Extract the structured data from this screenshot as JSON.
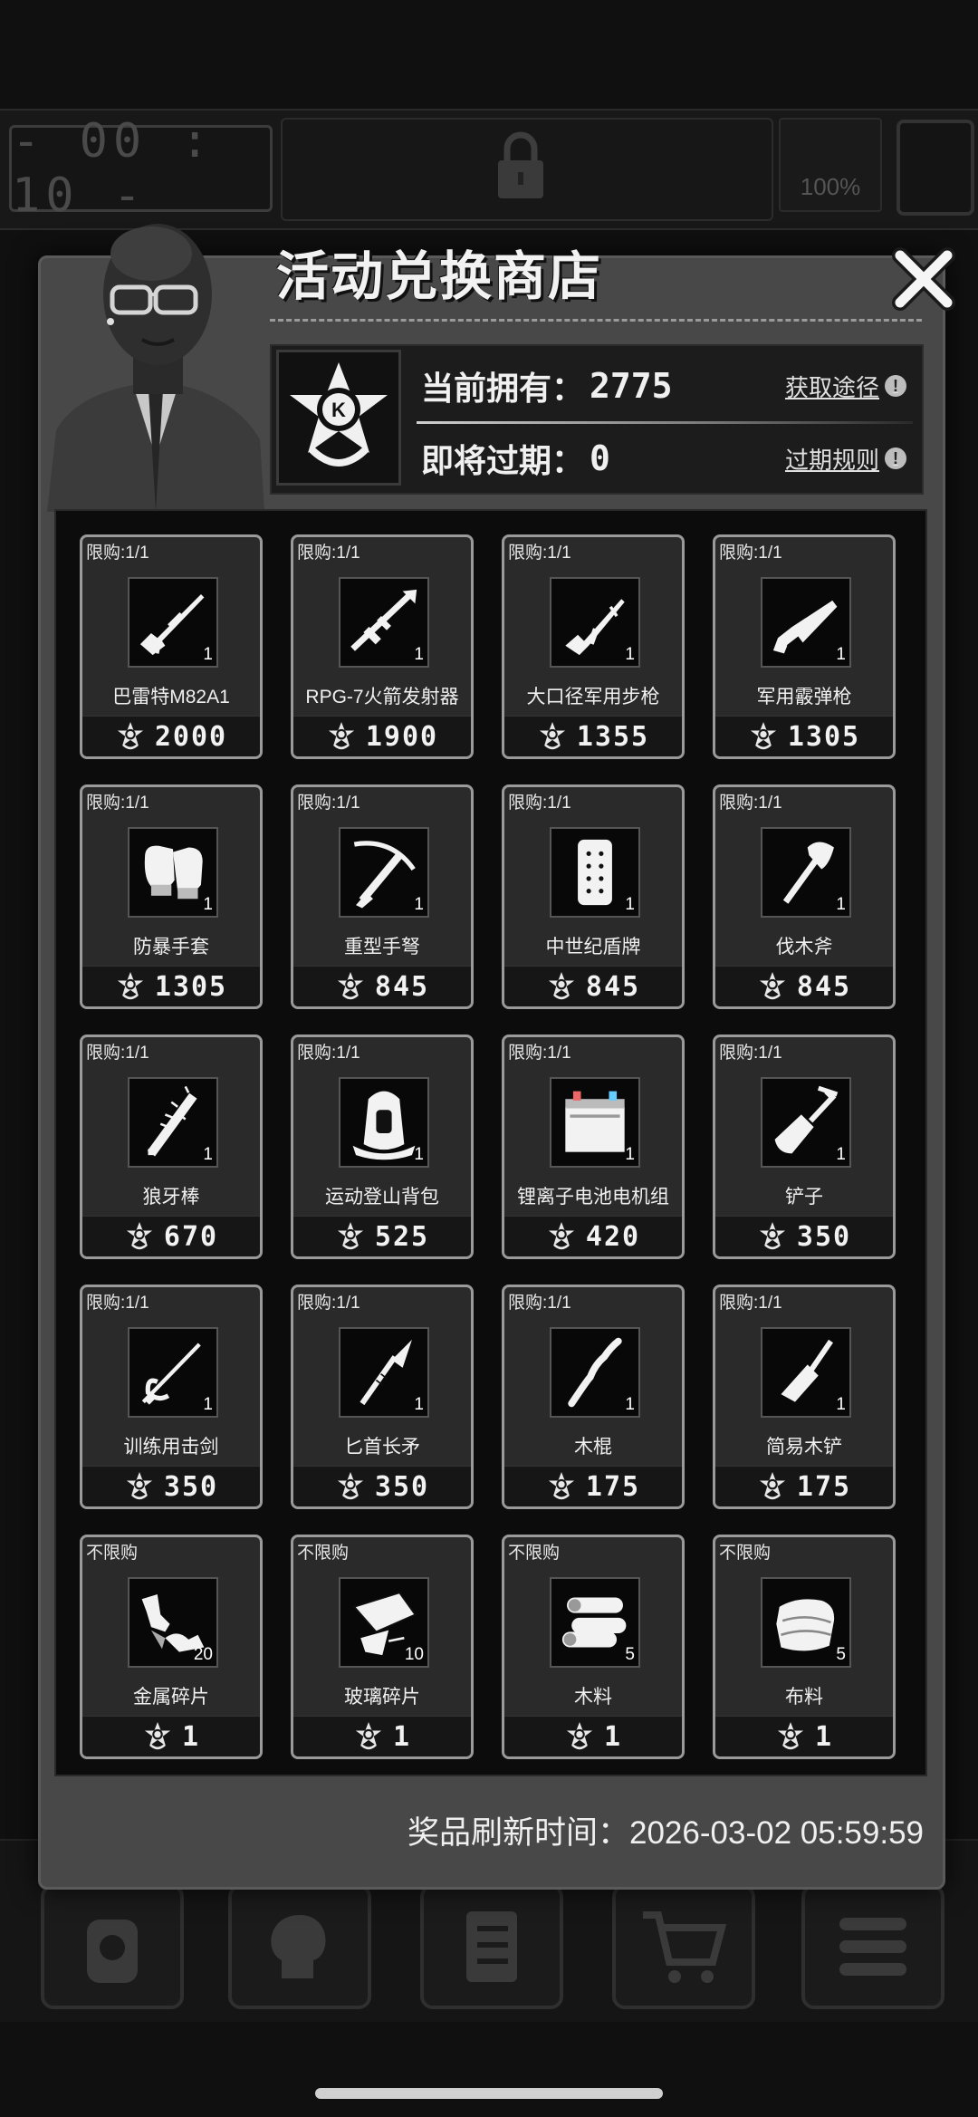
{
  "background": {
    "timer": "- 00 : 10 -",
    "battery_pct": "100%",
    "nav": [
      "backpack-icon",
      "brain-icon",
      "notes-icon",
      "cart-icon",
      "menu-icon"
    ]
  },
  "shop": {
    "title": "活动兑换商店",
    "owned_label": "当前拥有：",
    "owned_value": "2775",
    "expiring_label": "即将过期：",
    "expiring_value": "0",
    "obtain_link": "获取途径",
    "expire_rules_link": "过期规则",
    "refresh_label": "奖品刷新时间：",
    "refresh_time": "2026-03-02 05:59:59",
    "items": [
      {
        "limit": "限购:1/1",
        "name": "巴雷特M82A1",
        "qty": "1",
        "price": "2000",
        "icon": "sniper-rifle-icon"
      },
      {
        "limit": "限购:1/1",
        "name": "RPG-7火箭发射器",
        "qty": "1",
        "price": "1900",
        "icon": "rocket-launcher-icon"
      },
      {
        "limit": "限购:1/1",
        "name": "大口径军用步枪",
        "qty": "1",
        "price": "1355",
        "icon": "rifle-icon"
      },
      {
        "limit": "限购:1/1",
        "name": "军用霰弹枪",
        "qty": "1",
        "price": "1305",
        "icon": "shotgun-icon"
      },
      {
        "limit": "限购:1/1",
        "name": "防暴手套",
        "qty": "1",
        "price": "1305",
        "icon": "gloves-icon"
      },
      {
        "limit": "限购:1/1",
        "name": "重型手弩",
        "qty": "1",
        "price": "845",
        "icon": "crossbow-icon"
      },
      {
        "limit": "限购:1/1",
        "name": "中世纪盾牌",
        "qty": "1",
        "price": "845",
        "icon": "shield-icon"
      },
      {
        "limit": "限购:1/1",
        "name": "伐木斧",
        "qty": "1",
        "price": "845",
        "icon": "axe-icon"
      },
      {
        "limit": "限购:1/1",
        "name": "狼牙棒",
        "qty": "1",
        "price": "670",
        "icon": "spiked-club-icon"
      },
      {
        "limit": "限购:1/1",
        "name": "运动登山背包",
        "qty": "1",
        "price": "525",
        "icon": "backpack-icon"
      },
      {
        "limit": "限购:1/1",
        "name": "锂离子电池电机组",
        "qty": "1",
        "price": "420",
        "icon": "battery-icon"
      },
      {
        "limit": "限购:1/1",
        "name": "铲子",
        "qty": "1",
        "price": "350",
        "icon": "shovel-icon"
      },
      {
        "limit": "限购:1/1",
        "name": "训练用击剑",
        "qty": "1",
        "price": "350",
        "icon": "fencing-sword-icon"
      },
      {
        "limit": "限购:1/1",
        "name": "匕首长矛",
        "qty": "1",
        "price": "350",
        "icon": "spear-icon"
      },
      {
        "limit": "限购:1/1",
        "name": "木棍",
        "qty": "1",
        "price": "175",
        "icon": "stick-icon"
      },
      {
        "limit": "限购:1/1",
        "name": "简易木铲",
        "qty": "1",
        "price": "175",
        "icon": "wooden-spade-icon"
      },
      {
        "limit": "不限购",
        "name": "金属碎片",
        "qty": "20",
        "price": "1",
        "icon": "metal-scrap-icon"
      },
      {
        "limit": "不限购",
        "name": "玻璃碎片",
        "qty": "10",
        "price": "1",
        "icon": "glass-shard-icon"
      },
      {
        "limit": "不限购",
        "name": "木料",
        "qty": "5",
        "price": "1",
        "icon": "wood-logs-icon"
      },
      {
        "limit": "不限购",
        "name": "布料",
        "qty": "5",
        "price": "1",
        "icon": "cloth-icon"
      }
    ]
  }
}
